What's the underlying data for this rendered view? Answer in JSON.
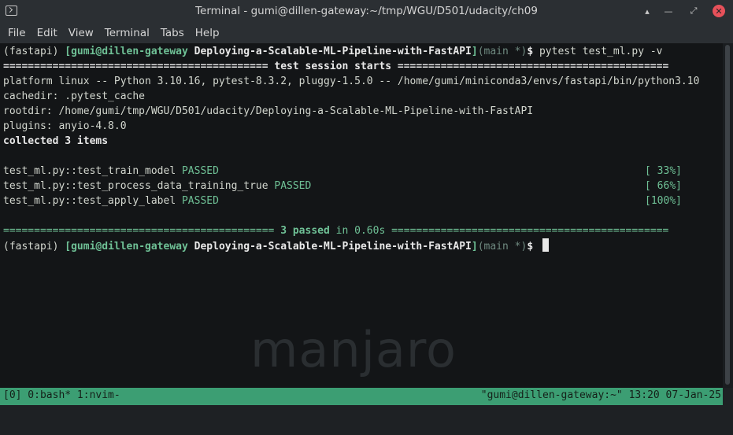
{
  "window": {
    "title": "Terminal - gumi@dillen-gateway:~/tmp/WGU/D501/udacity/ch09",
    "buttons": {
      "shade": "▴",
      "minimize": "—",
      "maximize": "⤢",
      "close": "✕"
    }
  },
  "menu": [
    "File",
    "Edit",
    "View",
    "Terminal",
    "Tabs",
    "Help"
  ],
  "prompt": {
    "env": "(fastapi) ",
    "userhost": "[gumi@dillen-gateway ",
    "dir": "Deploying-a-Scalable-ML-Pipeline-with-FastAPI",
    "close_bracket": "]",
    "branch": "(main *)",
    "dollar": "$ "
  },
  "command": "pytest test_ml.py -v",
  "session_header": "=========================================== test session starts ============================================",
  "output": {
    "platform": "platform linux -- Python 3.10.16, pytest-8.3.2, pluggy-1.5.0 -- /home/gumi/miniconda3/envs/fastapi/bin/python3.10",
    "cachedir": "cachedir: .pytest_cache",
    "rootdir": "rootdir: /home/gumi/tmp/WGU/D501/udacity/Deploying-a-Scalable-ML-Pipeline-with-FastAPI",
    "plugins": "plugins: anyio-4.8.0",
    "collected": "collected 3 items"
  },
  "tests": [
    {
      "name": "test_ml.py::test_train_model ",
      "status": "PASSED",
      "percent": "[ 33%]"
    },
    {
      "name": "test_ml.py::test_process_data_training_true ",
      "status": "PASSED",
      "percent": "[ 66%]"
    },
    {
      "name": "test_ml.py::test_apply_label ",
      "status": "PASSED",
      "percent": "[100%]"
    }
  ],
  "summary": {
    "left_rule": "============================================ ",
    "passed": "3 passed",
    "time": " in 0.60s ",
    "right_rule": "============================================="
  },
  "watermark": "manjaro",
  "statusbar": {
    "left": "[0] 0:bash* 1:nvim-",
    "right": "\"gumi@dillen-gateway:~\" 13:20 07-Jan-25"
  },
  "colors": {
    "accent": "#6fc196",
    "status_bg": "#3c9e73",
    "terminal_bg": "#131517"
  }
}
